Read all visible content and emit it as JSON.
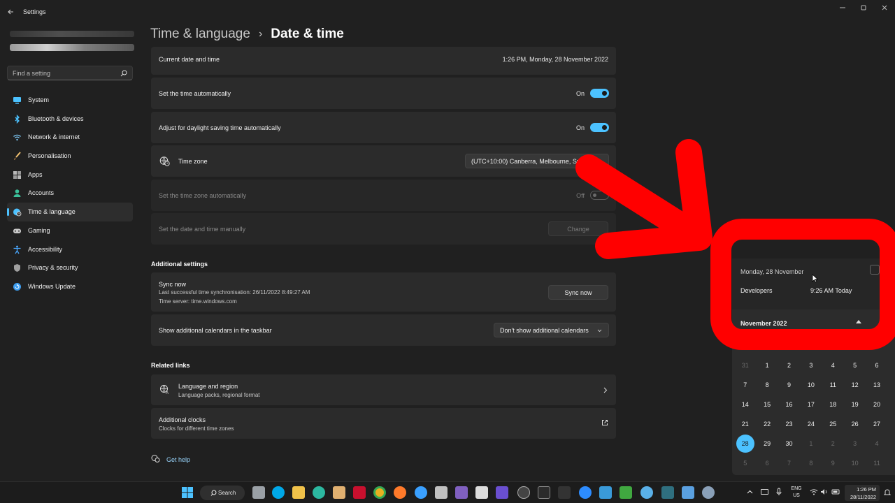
{
  "app": {
    "title": "Settings"
  },
  "sidebar": {
    "search_placeholder": "Find a setting",
    "items": [
      {
        "label": "System",
        "icon": "monitor-icon",
        "color": "#4cc2ff"
      },
      {
        "label": "Bluetooth & devices",
        "icon": "bluetooth-icon",
        "color": "#4cc2ff"
      },
      {
        "label": "Network & internet",
        "icon": "wifi-icon",
        "color": "#7cc6f2"
      },
      {
        "label": "Personalisation",
        "icon": "brush-icon",
        "color": "#e8a050"
      },
      {
        "label": "Apps",
        "icon": "apps-icon",
        "color": "#b8b8b8"
      },
      {
        "label": "Accounts",
        "icon": "person-icon",
        "color": "#3bc19a"
      },
      {
        "label": "Time & language",
        "icon": "globe-clock-icon",
        "color": "#4cc2ff"
      },
      {
        "label": "Gaming",
        "icon": "gamepad-icon",
        "color": "#c8c8c8"
      },
      {
        "label": "Accessibility",
        "icon": "accessibility-icon",
        "color": "#4aa8ff"
      },
      {
        "label": "Privacy & security",
        "icon": "shield-icon",
        "color": "#a0a0a0"
      },
      {
        "label": "Windows Update",
        "icon": "update-icon",
        "color": "#3d9df0"
      }
    ]
  },
  "header": {
    "parent": "Time & language",
    "separator": "›",
    "current": "Date & time"
  },
  "settings": {
    "current": {
      "label": "Current date and time",
      "value": "1:26 PM, Monday, 28 November 2022"
    },
    "auto_time": {
      "label": "Set the time automatically",
      "state": "On"
    },
    "dst": {
      "label": "Adjust for daylight saving time automatically",
      "state": "On"
    },
    "timezone": {
      "label": "Time zone",
      "value": "(UTC+10:00) Canberra, Melbourne, Sydney"
    },
    "auto_tz": {
      "label": "Set the time zone automatically",
      "state": "Off"
    },
    "manual": {
      "label": "Set the date and time manually",
      "button": "Change"
    }
  },
  "additional": {
    "title": "Additional settings",
    "sync": {
      "label": "Sync now",
      "last": "Last successful time synchronisation: 26/11/2022 8:49:27 AM",
      "server": "Time server: time.windows.com",
      "button": "Sync now"
    },
    "calendars": {
      "label": "Show additional calendars in the taskbar",
      "value": "Don't show additional calendars"
    }
  },
  "related": {
    "title": "Related links",
    "language": {
      "label": "Language and region",
      "sub": "Language packs, regional format"
    },
    "clocks": {
      "label": "Additional clocks",
      "sub": "Clocks for different time zones"
    }
  },
  "help": {
    "label": "Get help"
  },
  "flyout": {
    "date": "Monday, 28 November",
    "event_title": "Developers",
    "event_time": "9:26 AM Today",
    "month": "November 2022",
    "days": [
      {
        "d": "31",
        "o": true
      },
      {
        "d": "1"
      },
      {
        "d": "2"
      },
      {
        "d": "3"
      },
      {
        "d": "4"
      },
      {
        "d": "5"
      },
      {
        "d": "6"
      },
      {
        "d": "7"
      },
      {
        "d": "8"
      },
      {
        "d": "9"
      },
      {
        "d": "10"
      },
      {
        "d": "11"
      },
      {
        "d": "12"
      },
      {
        "d": "13"
      },
      {
        "d": "14"
      },
      {
        "d": "15"
      },
      {
        "d": "16"
      },
      {
        "d": "17"
      },
      {
        "d": "18"
      },
      {
        "d": "19"
      },
      {
        "d": "20"
      },
      {
        "d": "21"
      },
      {
        "d": "22"
      },
      {
        "d": "23"
      },
      {
        "d": "24"
      },
      {
        "d": "25"
      },
      {
        "d": "26"
      },
      {
        "d": "27"
      },
      {
        "d": "28",
        "today": true
      },
      {
        "d": "29"
      },
      {
        "d": "30"
      },
      {
        "d": "1",
        "o": true
      },
      {
        "d": "2",
        "o": true
      },
      {
        "d": "3",
        "o": true
      },
      {
        "d": "4",
        "o": true
      },
      {
        "d": "5",
        "o": true
      },
      {
        "d": "6",
        "o": true
      },
      {
        "d": "7",
        "o": true
      },
      {
        "d": "8",
        "o": true
      },
      {
        "d": "9",
        "o": true
      },
      {
        "d": "10",
        "o": true
      },
      {
        "d": "11",
        "o": true
      }
    ]
  },
  "taskbar": {
    "search_label": "Search",
    "lang_top": "ENG",
    "lang_bottom": "US",
    "time": "1:26 PM",
    "date": "28/11/2022"
  },
  "colors": {
    "accent": "#4cc2ff",
    "annotation": "#ff0000",
    "background": "#202020",
    "card": "#2b2b2b"
  }
}
